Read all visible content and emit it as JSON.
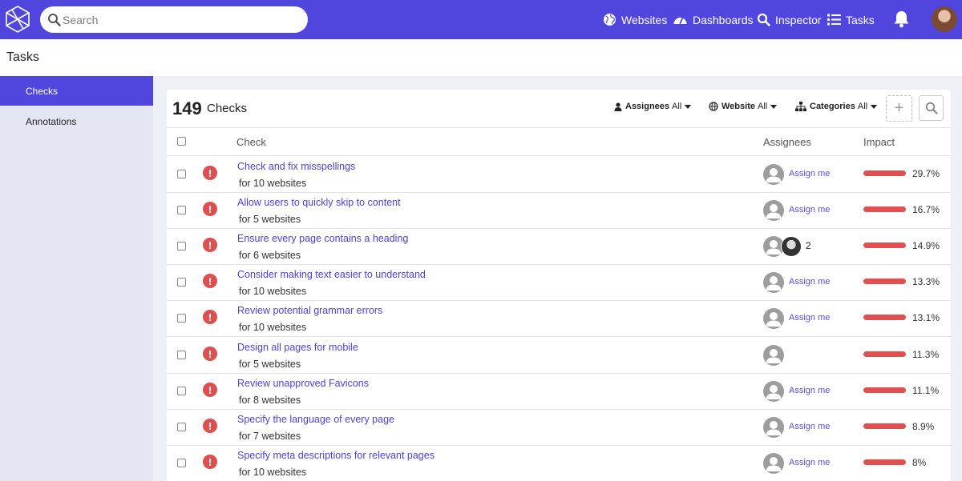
{
  "nav": {
    "search_placeholder": "Search",
    "items": [
      {
        "label": "Websites",
        "icon": "globe-icon"
      },
      {
        "label": "Dashboards",
        "icon": "gauge-icon"
      },
      {
        "label": "Inspector",
        "icon": "search-icon"
      },
      {
        "label": "Tasks",
        "icon": "list-icon"
      }
    ]
  },
  "page": {
    "title": "Tasks"
  },
  "sidebar": {
    "items": [
      {
        "label": "Checks",
        "active": true
      },
      {
        "label": "Annotations",
        "active": false
      }
    ]
  },
  "panel": {
    "count": "149",
    "count_label": "Checks",
    "filters": [
      {
        "label": "Assignees",
        "value": "All",
        "icon": "person-icon"
      },
      {
        "label": "Website",
        "value": "All",
        "icon": "globe-icon"
      },
      {
        "label": "Categories",
        "value": "All",
        "icon": "hierarchy-icon"
      }
    ],
    "add_button": "+"
  },
  "table": {
    "headers": {
      "check": "Check",
      "assignees": "Assignees",
      "impact": "Impact"
    },
    "assign_label": "Assign me",
    "rows": [
      {
        "title": "Check and fix misspellings",
        "sub": "for 10 websites",
        "assign": "Assign me",
        "impact": "29.7%",
        "impact_value": 29.7
      },
      {
        "title": "Allow users to quickly skip to content",
        "sub": "for 5 websites",
        "assign": "Assign me",
        "impact": "16.7%",
        "impact_value": 16.7
      },
      {
        "title": "Ensure every page contains a heading",
        "sub": "for 6 websites",
        "assign": "",
        "assignee_count": "2",
        "impact": "14.9%",
        "impact_value": 14.9
      },
      {
        "title": "Consider making text easier to understand",
        "sub": "for 10 websites",
        "assign": "Assign me",
        "impact": "13.3%",
        "impact_value": 13.3
      },
      {
        "title": "Review potential grammar errors",
        "sub": "for 10 websites",
        "assign": "Assign me",
        "impact": "13.1%",
        "impact_value": 13.1
      },
      {
        "title": "Design all pages for mobile",
        "sub": "for 5 websites",
        "assign": "",
        "impact": "11.3%",
        "impact_value": 11.3
      },
      {
        "title": "Review unapproved Favicons",
        "sub": "for 8 websites",
        "assign": "Assign me",
        "impact": "11.1%",
        "impact_value": 11.1
      },
      {
        "title": "Specify the language of every page",
        "sub": "for 7 websites",
        "assign": "Assign me",
        "impact": "8.9%",
        "impact_value": 8.9
      },
      {
        "title": "Specify meta descriptions for relevant pages",
        "sub": "for 10 websites",
        "assign": "Assign me",
        "impact": "8%",
        "impact_value": 8
      }
    ]
  },
  "colors": {
    "brand": "#5046dd",
    "link": "#4d3fd9",
    "impact_bar": "#e05050",
    "warning": "#dd5050"
  }
}
